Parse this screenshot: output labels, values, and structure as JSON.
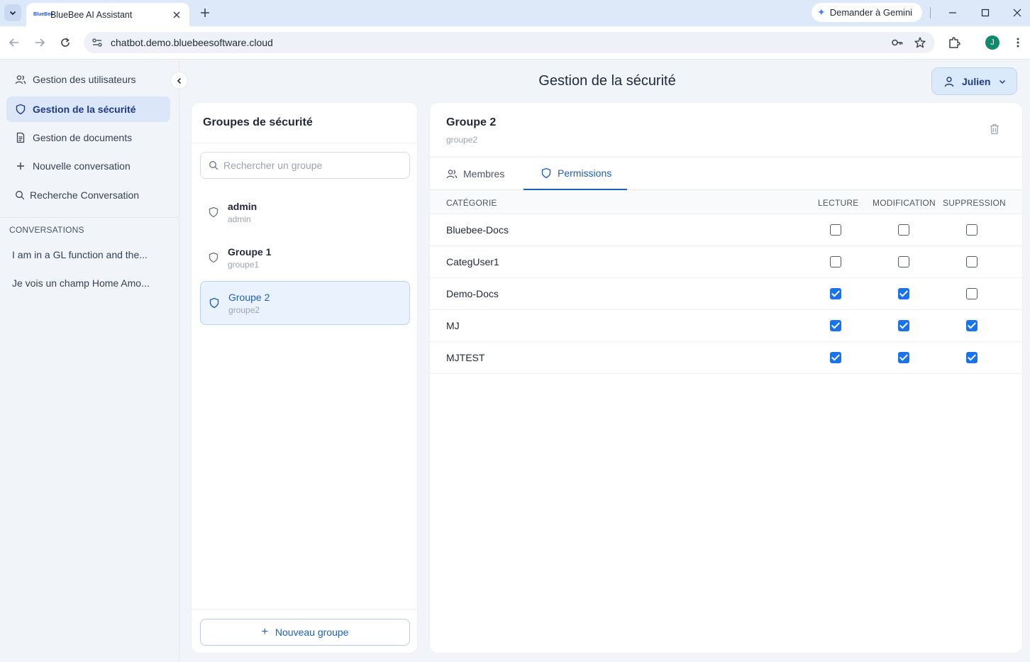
{
  "browser": {
    "tab_title": "BlueBee AI Assistant",
    "favicon_text": "BlueBee",
    "url": "chatbot.demo.bluebeesoftware.cloud",
    "gemini_label": "Demander à Gemini",
    "profile_initial": "J"
  },
  "sidebar": {
    "items": [
      {
        "label": "Gestion des utilisateurs",
        "icon": "users-icon"
      },
      {
        "label": "Gestion de la sécurité",
        "icon": "shield-icon",
        "active": true
      },
      {
        "label": "Gestion de documents",
        "icon": "document-icon"
      },
      {
        "label": "Nouvelle conversation",
        "icon": "plus-icon"
      },
      {
        "label": "Recherche Conversation",
        "icon": "search-icon"
      }
    ],
    "section_title": "CONVERSATIONS",
    "conversations": [
      "I am in a GL function and the...",
      "Je vois un champ Home Amo..."
    ]
  },
  "header": {
    "title": "Gestion de la sécurité",
    "user_name": "Julien"
  },
  "groups_panel": {
    "title": "Groupes de sécurité",
    "search_placeholder": "Rechercher un groupe",
    "groups": [
      {
        "name": "admin",
        "slug": "admin"
      },
      {
        "name": "Groupe 1",
        "slug": "groupe1"
      },
      {
        "name": "Groupe 2",
        "slug": "groupe2",
        "selected": true
      }
    ],
    "new_group_label": "Nouveau groupe"
  },
  "detail": {
    "title": "Groupe 2",
    "slug": "groupe2",
    "tabs": [
      {
        "label": "Membres"
      },
      {
        "label": "Permissions",
        "active": true
      }
    ],
    "columns": [
      "CATÉGORIE",
      "LECTURE",
      "MODIFICATION",
      "SUPPRESSION"
    ],
    "rows": [
      {
        "category": "Bluebee-Docs",
        "read": false,
        "modify": false,
        "delete": false
      },
      {
        "category": "CategUser1",
        "read": false,
        "modify": false,
        "delete": false
      },
      {
        "category": "Demo-Docs",
        "read": true,
        "modify": true,
        "delete": false
      },
      {
        "category": "MJ",
        "read": true,
        "modify": true,
        "delete": true
      },
      {
        "category": "MJTEST",
        "read": true,
        "modify": true,
        "delete": true
      }
    ]
  },
  "colors": {
    "accent": "#1d5fbf",
    "checkbox": "#1a73e8",
    "sidebar_active": "#dbe7f8"
  }
}
